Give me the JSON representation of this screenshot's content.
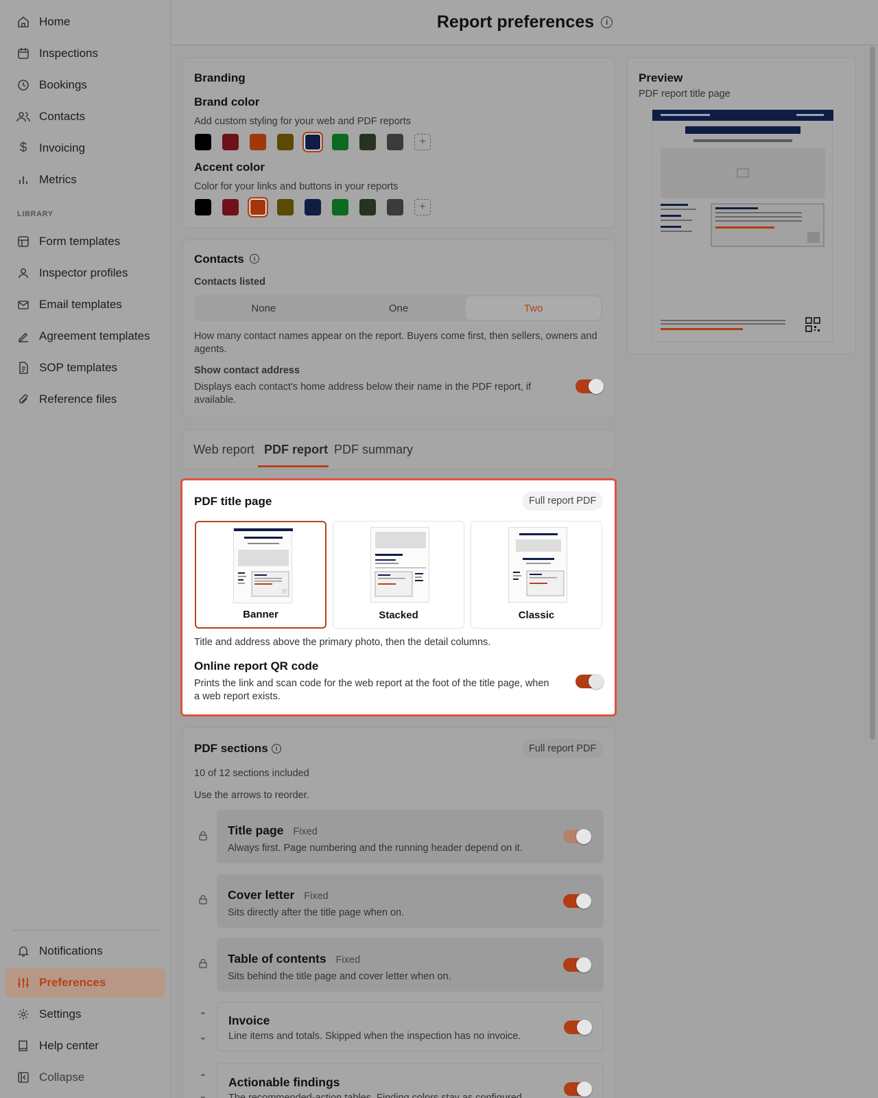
{
  "header": {
    "title": "Report preferences"
  },
  "sidebar": {
    "items": [
      {
        "label": "Home",
        "icon": "home-icon"
      },
      {
        "label": "Inspections",
        "icon": "calendar-icon"
      },
      {
        "label": "Bookings",
        "icon": "clock-icon"
      },
      {
        "label": "Contacts",
        "icon": "users-icon"
      },
      {
        "label": "Invoicing",
        "icon": "dollar-icon"
      },
      {
        "label": "Metrics",
        "icon": "bar-chart-icon"
      }
    ],
    "library_label": "LIBRARY",
    "library_items": [
      {
        "label": "Form templates",
        "icon": "layout-icon"
      },
      {
        "label": "Inspector profiles",
        "icon": "user-icon"
      },
      {
        "label": "Email templates",
        "icon": "mail-icon"
      },
      {
        "label": "Agreement templates",
        "icon": "signature-icon"
      },
      {
        "label": "SOP templates",
        "icon": "file-text-icon"
      },
      {
        "label": "Reference files",
        "icon": "paperclip-icon"
      }
    ],
    "bottom_items": [
      {
        "label": "Notifications",
        "icon": "bell-icon"
      },
      {
        "label": "Preferences",
        "icon": "sliders-icon",
        "active": true
      },
      {
        "label": "Settings",
        "icon": "gear-icon"
      },
      {
        "label": "Help center",
        "icon": "book-icon"
      },
      {
        "label": "Collapse",
        "icon": "collapse-icon"
      }
    ]
  },
  "branding": {
    "title": "Branding",
    "brand_color": {
      "label": "Brand color",
      "hint": "Add custom styling for your web and PDF reports",
      "swatches": [
        "#000000",
        "#6e1218",
        "#a33708",
        "#5a4a06",
        "#0f1d45",
        "#0c6a21",
        "#263222",
        "#3b3b3b"
      ],
      "selected": "#0f1d45"
    },
    "accent_color": {
      "label": "Accent color",
      "hint": "Color for your links and buttons in your reports",
      "swatches": [
        "#000000",
        "#6e1218",
        "#a33708",
        "#5a4a06",
        "#0f1d45",
        "#0c6a21",
        "#263222",
        "#3b3b3b"
      ],
      "selected": "#a33708"
    }
  },
  "contacts": {
    "title": "Contacts",
    "listed_label": "Contacts listed",
    "options": [
      "None",
      "One",
      "Two"
    ],
    "selected": "Two",
    "listed_hint": "How many contact names appear on the report. Buyers come first, then sellers, owners and agents.",
    "address_label": "Show contact address",
    "address_hint": "Displays each contact's home address below their name in the PDF report, if available.",
    "address_enabled": true
  },
  "tabs": [
    {
      "label": "Web report"
    },
    {
      "label": "PDF report",
      "active": true
    },
    {
      "label": "PDF summary"
    }
  ],
  "title_page": {
    "title": "PDF title page",
    "badge": "Full report PDF",
    "options": [
      {
        "label": "Banner",
        "selected": true
      },
      {
        "label": "Stacked"
      },
      {
        "label": "Classic"
      }
    ],
    "description": "Title and address above the primary photo, then the detail columns.",
    "qr_label": "Online report QR code",
    "qr_hint": "Prints the link and scan code for the web report at the foot of the title page, when a web report exists.",
    "qr_enabled": true
  },
  "sections": {
    "title": "PDF sections",
    "badge": "Full report PDF",
    "count_text": "10 of 12 sections included",
    "reorder_hint": "Use the arrows to reorder.",
    "items": [
      {
        "name": "Title page",
        "tag": "Fixed",
        "desc": "Always first. Page numbering and the running header depend on it.",
        "enabled": true
      },
      {
        "name": "Cover letter",
        "tag": "Fixed",
        "desc": "Sits directly after the title page when on.",
        "enabled": true
      },
      {
        "name": "Table of contents",
        "tag": "Fixed",
        "desc": "Sits behind the title page and cover letter when on.",
        "enabled": true
      },
      {
        "name": "Invoice",
        "tag": "",
        "desc": "Line items and totals. Skipped when the inspection has no invoice.",
        "enabled": true
      },
      {
        "name": "Actionable findings",
        "tag": "",
        "desc": "The recommended-action tables. Finding colors stay as configured.",
        "enabled": true
      }
    ]
  },
  "preview": {
    "title": "Preview",
    "subtitle": "PDF report title page"
  },
  "colors": {
    "accent": "#b3431a",
    "brand": "#0f1d45",
    "highlight": "#e0533d"
  }
}
